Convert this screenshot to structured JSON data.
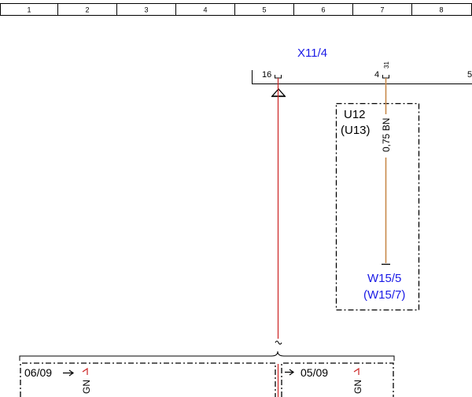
{
  "grid": {
    "columns": [
      "1",
      "2",
      "3",
      "4",
      "5",
      "6",
      "7",
      "8"
    ]
  },
  "connector_x11_4": {
    "name": "X11/4",
    "pin_left": "16",
    "pin_right": "4",
    "pin_edge": "5",
    "pin_right_top": "31"
  },
  "component": {
    "name": "U12",
    "alt": "(U13)"
  },
  "wire": {
    "label": "0,75 BN",
    "color": "#c8894a"
  },
  "main_wire": {
    "color": "#cc2222"
  },
  "connector_w15": {
    "name": "W15/5",
    "alt": "(W15/7)"
  },
  "refs": {
    "left": "06/09",
    "right": "05/09",
    "gn_left": "GN",
    "gn_right": "GN"
  },
  "colors": {
    "connector_label": "#1a1ae6"
  }
}
